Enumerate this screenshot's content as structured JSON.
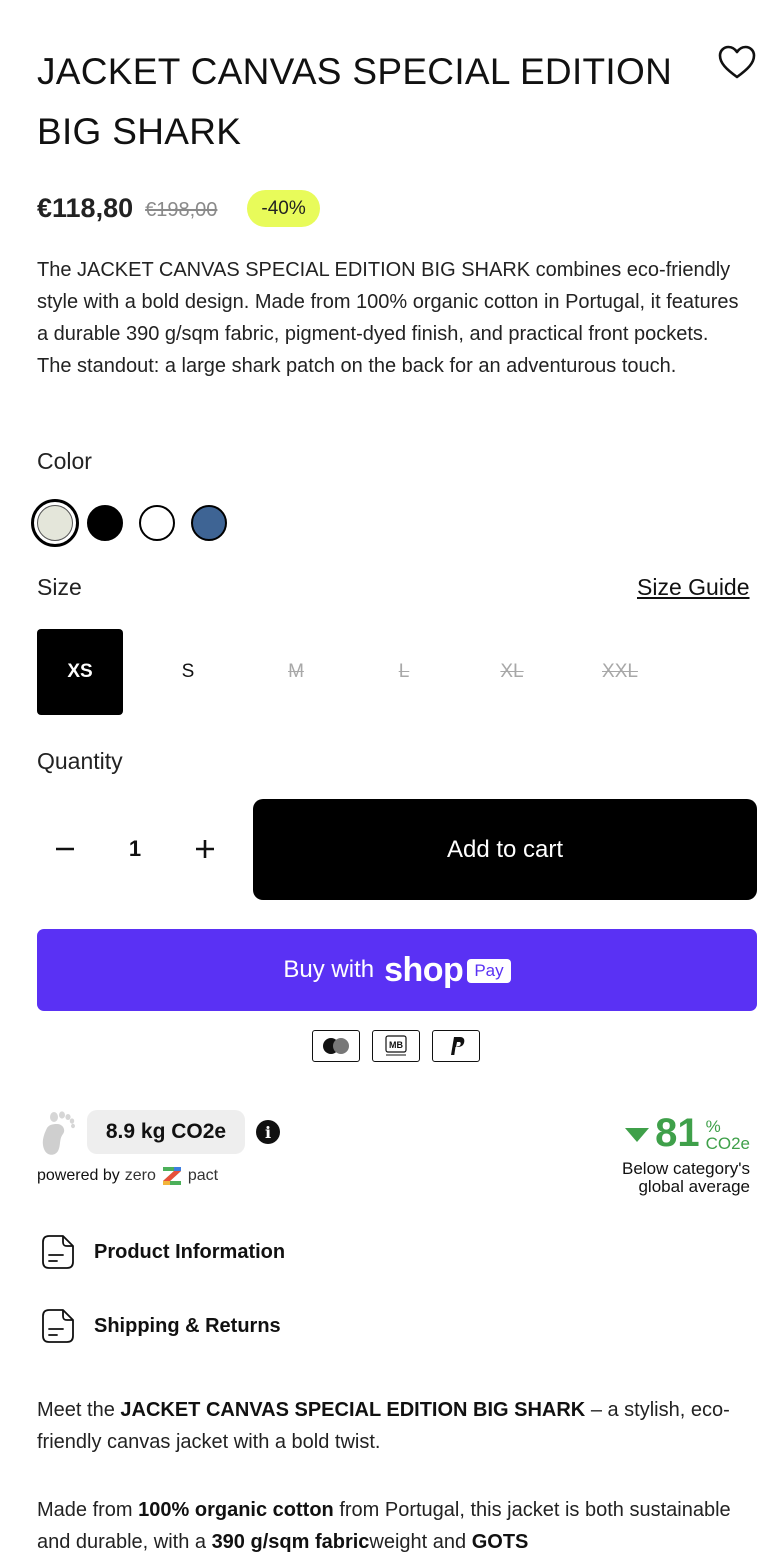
{
  "product": {
    "title": "JACKET CANVAS SPECIAL EDITION BIG SHARK",
    "price": "€118,80",
    "compare_price": "€198,00",
    "discount_badge": "-40%",
    "description": "The JACKET CANVAS SPECIAL EDITION BIG SHARK combines eco-friendly style with a bold design. Made from 100% organic cotton in Portugal, it features a durable 390 g/sqm fabric, pigment-dyed finish, and practical front pockets. The standout: a large shark patch on the back for an adventurous touch."
  },
  "color": {
    "label": "Color",
    "swatches": [
      {
        "hex": "#e4e6da",
        "selected": true
      },
      {
        "hex": "#000000",
        "selected": false
      },
      {
        "hex": "#ffffff",
        "selected": false
      },
      {
        "hex": "#3e6494",
        "selected": false
      }
    ]
  },
  "size": {
    "label": "Size",
    "guide_label": "Size Guide",
    "options": [
      {
        "label": "XS",
        "state": "selected"
      },
      {
        "label": "S",
        "state": "available"
      },
      {
        "label": "M",
        "state": "unavailable"
      },
      {
        "label": "L",
        "state": "unavailable"
      },
      {
        "label": "XL",
        "state": "unavailable"
      },
      {
        "label": "XXL",
        "state": "unavailable"
      }
    ]
  },
  "quantity": {
    "label": "Quantity",
    "value": "1"
  },
  "buttons": {
    "add_to_cart": "Add to cart",
    "buy_with": "Buy with",
    "shop_logo": "shop",
    "pay_pill": "Pay"
  },
  "payment_icons": [
    "mastercard-icon",
    "multibanco-icon",
    "paypal-icon"
  ],
  "payment_icon_text": {
    "multibanco": "MB"
  },
  "carbon": {
    "value": "8.9 kg CO2e",
    "info": "i",
    "powered_by": "powered by",
    "brand_left": "zero",
    "brand_right": "pact",
    "stat_value": "81",
    "stat_pct": "%",
    "stat_unit": "CO2e",
    "stat_note_1": "Below category's",
    "stat_note_2": "global average",
    "accent_color": "#3fa04a"
  },
  "accordions": {
    "product_info": "Product Information",
    "shipping": "Shipping & Returns"
  },
  "long_description": {
    "p1_prefix": "Meet the ",
    "p1_bold": "JACKET CANVAS SPECIAL EDITION BIG SHARK",
    "p1_suffix": " – a stylish, eco-friendly canvas jacket with a bold twist.",
    "p2_prefix": "Made from ",
    "p2_bold1": "100% organic cotton",
    "p2_mid": " from Portugal, this jacket is both sustainable and durable, with a ",
    "p2_bold2": "390 g/sqm fabric",
    "p2_mid2": "weight and ",
    "p2_bold3": "GOTS"
  },
  "colors": {
    "shop_purple": "#5a31f4",
    "badge_yellow": "#e8fb5a"
  }
}
